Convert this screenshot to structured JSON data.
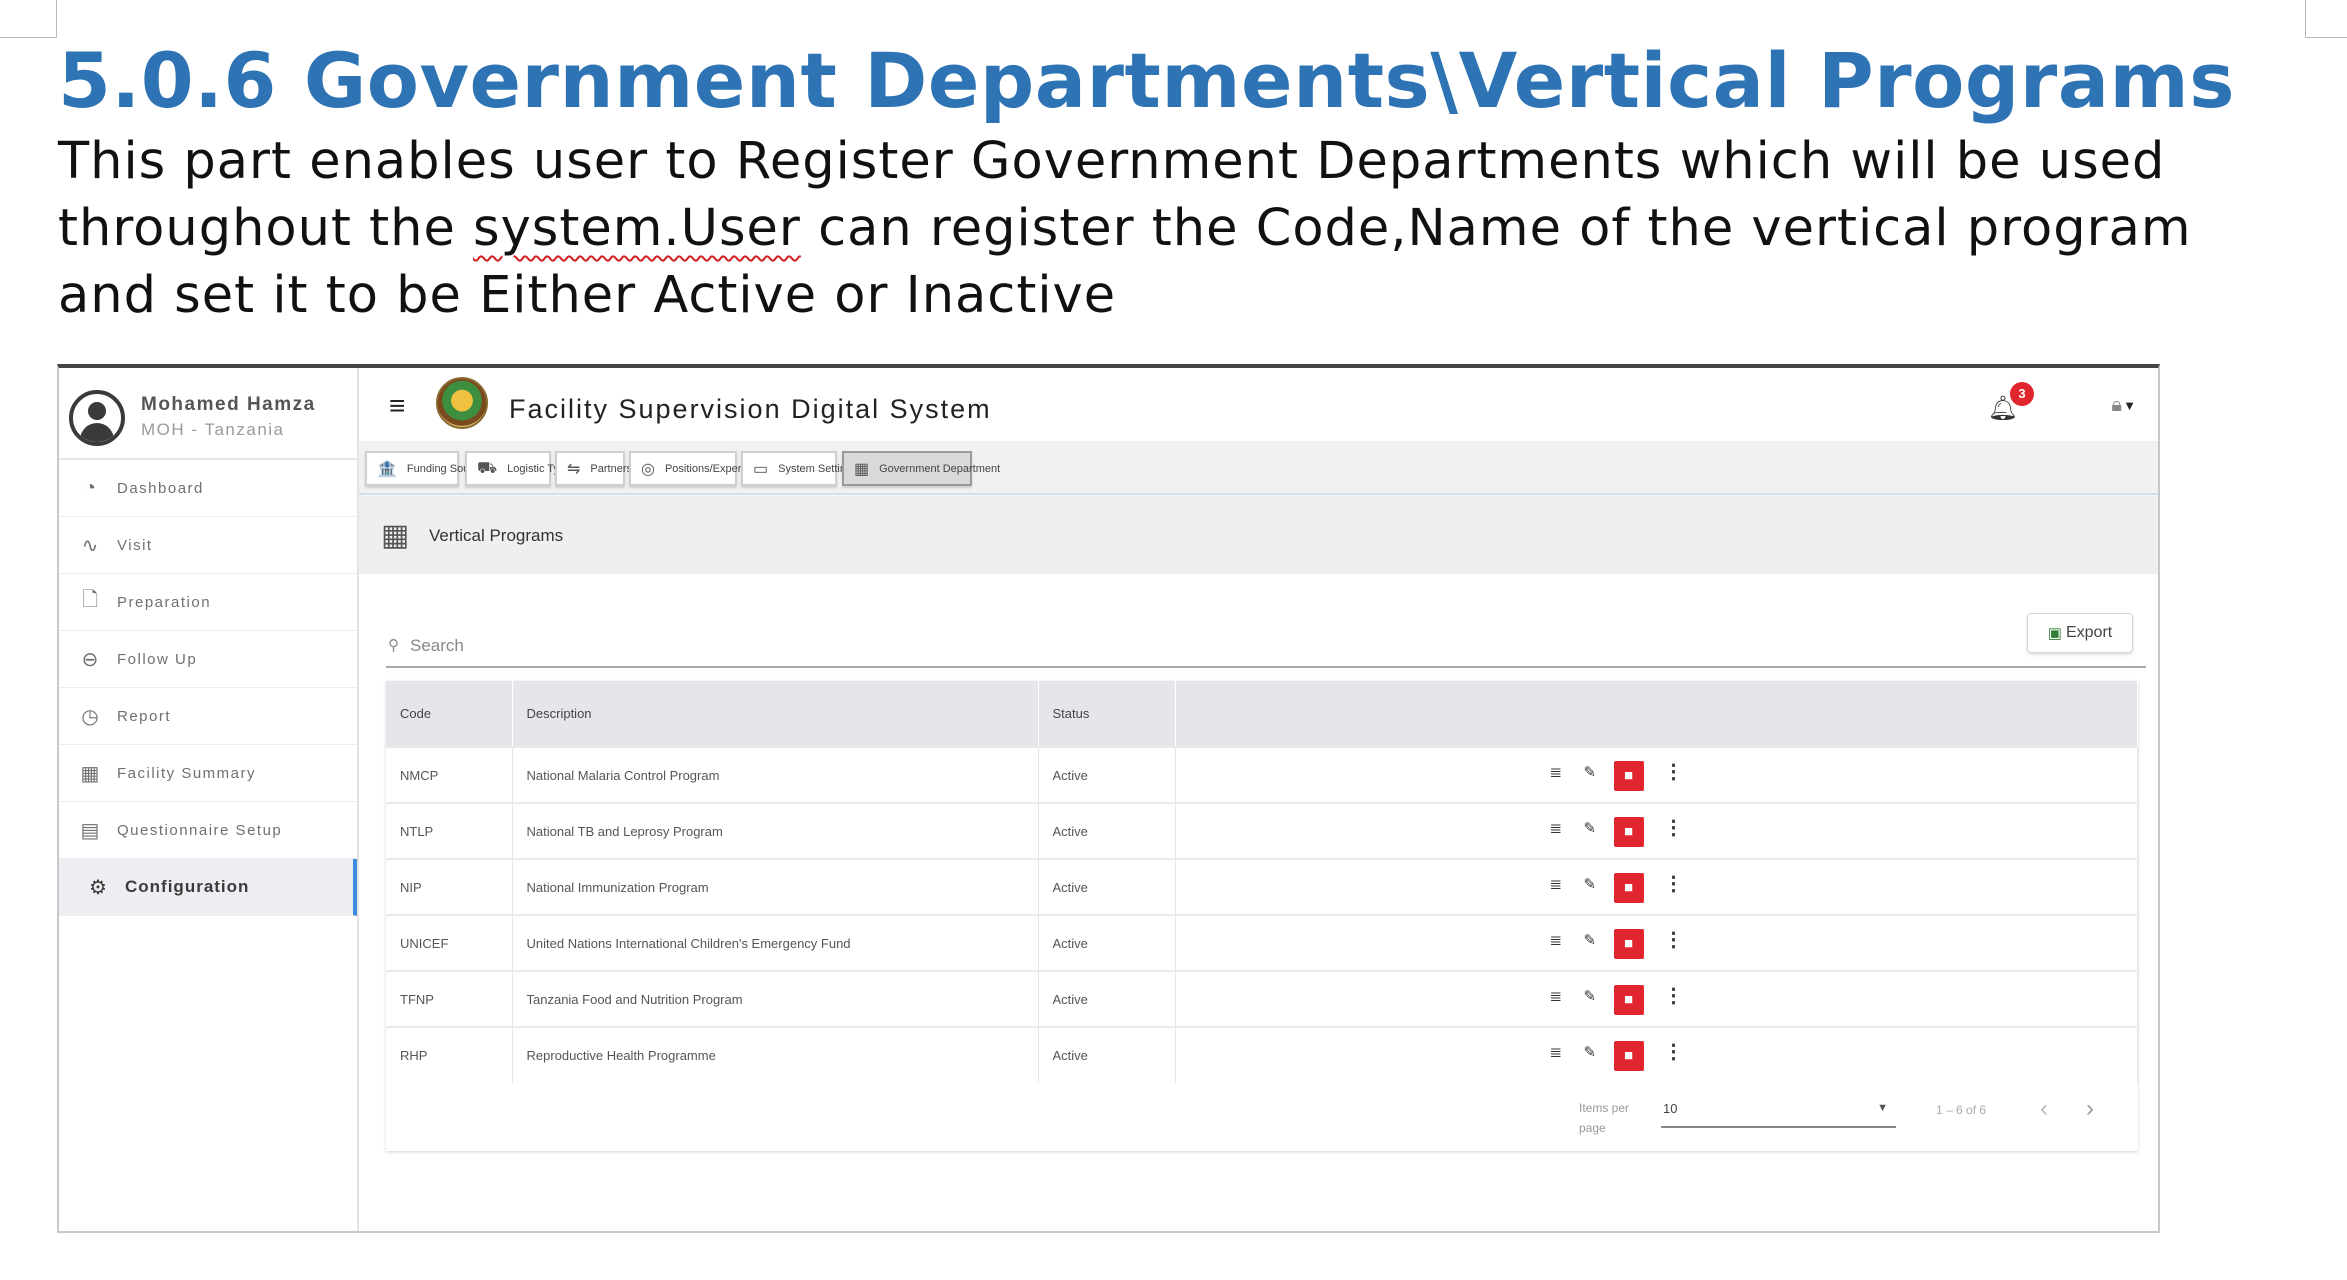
{
  "document": {
    "heading": "5.0.6 Government Departments\\Vertical Programs",
    "paragraph_before": "This part enables user to Register Government Departments which will be used throughout the ",
    "paragraph_misspelled": "system.User",
    "paragraph_after": " can register the Code,Name of the vertical program and set it to be Either Active or Inactive"
  },
  "app": {
    "title": "Facility Supervision Digital System",
    "notification_count": "3",
    "user": {
      "name": "Mohamed Hamza",
      "org": "MOH - Tanzania"
    }
  },
  "sidebar": {
    "items": [
      {
        "label": "Dashboard",
        "icon": "gauge-icon",
        "glyph": "◔"
      },
      {
        "label": "Visit",
        "icon": "pulse-icon",
        "glyph": "∿"
      },
      {
        "label": "Preparation",
        "icon": "file-search-icon",
        "glyph": "🗋"
      },
      {
        "label": "Follow Up",
        "icon": "minus-circle-icon",
        "glyph": "⊖"
      },
      {
        "label": "Report",
        "icon": "pie-chart-icon",
        "glyph": "◷"
      },
      {
        "label": "Facility Summary",
        "icon": "building-icon",
        "glyph": "▦"
      },
      {
        "label": "Questionnaire Setup",
        "icon": "clipboard-icon",
        "glyph": "▤"
      },
      {
        "label": "Configuration",
        "icon": "gears-icon",
        "glyph": "⚙"
      }
    ],
    "active_index": 7
  },
  "tabs": [
    {
      "label": "Funding Source",
      "icon": "bank-icon",
      "glyph": "🏦"
    },
    {
      "label": "Logistic Type",
      "icon": "truck-icon",
      "glyph": "⛟"
    },
    {
      "label": "Partners",
      "icon": "handshake-icon",
      "glyph": "⇋"
    },
    {
      "label": "Positions/Expertise",
      "icon": "target-icon",
      "glyph": "◎"
    },
    {
      "label": "System Settings",
      "icon": "window-settings-icon",
      "glyph": "▭"
    },
    {
      "label": "Government Department",
      "icon": "building-icon",
      "glyph": "▦"
    }
  ],
  "page": {
    "title": "Vertical Programs",
    "search_placeholder": "Search",
    "export_label": "Export"
  },
  "table": {
    "columns": [
      "Code",
      "Description",
      "Status",
      ""
    ],
    "rows": [
      {
        "code": "NMCP",
        "description": "National Malaria Control Program",
        "status": "Active"
      },
      {
        "code": "NTLP",
        "description": "National TB and Leprosy Program",
        "status": "Active"
      },
      {
        "code": "NIP",
        "description": "National Immunization Program",
        "status": "Active"
      },
      {
        "code": "UNICEF",
        "description": "United Nations International Children's Emergency Fund",
        "status": "Active"
      },
      {
        "code": "TFNP",
        "description": "Tanzania Food and Nutrition Program",
        "status": "Active"
      },
      {
        "code": "RHP",
        "description": "Reproductive Health Programme",
        "status": "Active"
      }
    ]
  },
  "paginator": {
    "items_per_page_label": "Items per page",
    "items_per_page_value": "10",
    "range_label": "1 – 6 of 6"
  },
  "colors": {
    "heading_blue": "#2e74b5",
    "delete_red": "#e0252e",
    "active_accent": "#3d8be0"
  }
}
